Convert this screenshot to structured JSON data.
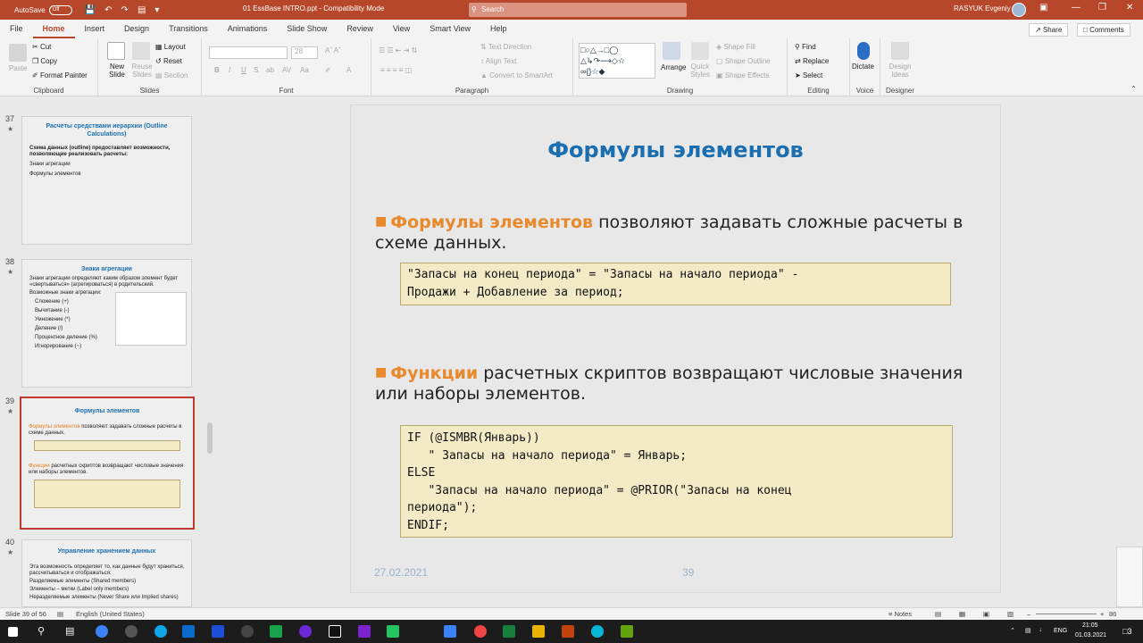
{
  "titlebar": {
    "autosave_label": "AutoSave",
    "autosave_state": "Off",
    "document_title": "01 EssBase INTRO.ppt  -  Compatibility Mode",
    "search_placeholder": "Search",
    "user_name": "RASYUK Evgeniy",
    "accent_color": "#b7472a"
  },
  "tabs": [
    "File",
    "Home",
    "Insert",
    "Design",
    "Transitions",
    "Animations",
    "Slide Show",
    "Review",
    "View",
    "Smart View",
    "Help"
  ],
  "active_tab": "Home",
  "share_label": "Share",
  "comments_label": "Comments",
  "ribbon": {
    "clipboard": {
      "label": "Clipboard",
      "paste": "Paste",
      "cut": "Cut",
      "copy": "Copy",
      "format_painter": "Format Painter"
    },
    "slides": {
      "label": "Slides",
      "new_slide": "New Slide",
      "reuse_slides": "Reuse Slides",
      "layout": "Layout",
      "reset": "Reset",
      "section": "Section"
    },
    "font": {
      "label": "Font",
      "size": "28"
    },
    "paragraph": {
      "label": "Paragraph",
      "text_direction": "Text Direction",
      "align_text": "Align Text",
      "convert_smartart": "Convert to SmartArt"
    },
    "drawing": {
      "label": "Drawing",
      "arrange": "Arrange",
      "quick_styles": "Quick Styles",
      "shape_fill": "Shape Fill",
      "shape_outline": "Shape Outline",
      "shape_effects": "Shape Effects"
    },
    "editing": {
      "label": "Editing",
      "find": "Find",
      "replace": "Replace",
      "select": "Select"
    },
    "voice": {
      "label": "Voice",
      "dictate": "Dictate"
    },
    "designer": {
      "label": "Designer",
      "design_ideas": "Design Ideas"
    }
  },
  "thumbnails": [
    {
      "num": "37",
      "title": "Расчеты средствами иерархии (Outline Calculations)",
      "lines": [
        "Схема данных (outline) предоставляет возможности, позволяющие реализовать расчеты:",
        "Знаки агрегации",
        "Формулы элементов"
      ]
    },
    {
      "num": "38",
      "title": "Знаки агрегации",
      "lines": [
        "Знаки агрегации определяют каким образом элемент будет «свертываться» (агрегироваться) в родительский.",
        "Возможные знаки агрегации:",
        "Сложение (+)",
        "Вычитание (-)",
        "Умножение (*)",
        "Деление (/)",
        "Процентное деление (%)",
        "Игнорирование (~)"
      ]
    },
    {
      "num": "39",
      "title": "Формулы элементов",
      "lines": [
        "позволяют задавать сложные расчеты в схеме данных.",
        "расчетных скриптов возвращают числовые значения или наборы элементов."
      ],
      "hl1": "Формулы элементов",
      "hl2": "Функции"
    },
    {
      "num": "40",
      "title": "Управление хранением данных",
      "lines": [
        "Эта возможность определяет то, как данные будут храниться, рассчитываться и отображаться:",
        "Разделяемые элементы (Shared members)",
        "Элементы – метки (Label only members)",
        "Неразделяемые элементы (Never Share или Implied shares)"
      ]
    }
  ],
  "slide": {
    "title": "Формулы элементов",
    "bullet1_highlight": "Формулы элементов",
    "bullet1_text": " позволяют задавать сложные расчеты в схеме данных.",
    "code1": "\"Запасы на конец периода\" = \"Запасы на начало периода\" -\nПродажи + Добавление за период;",
    "bullet2_highlight": "Функции",
    "bullet2_text": " расчетных скриптов возвращают числовые значения или наборы элементов.",
    "code2": "IF (@ISMBR(Январь))\n   \" Запасы на начало периода\" = Январь;\nELSE\n   \"Запасы на начало периода\" = @PRIOR(\"Запасы на конец\nпериода\");\nENDIF;",
    "footer_date": "27.02.2021",
    "footer_page": "39"
  },
  "status": {
    "slide_counter": "Slide 39 of 56",
    "language": "English (United States)",
    "notes": "Notes",
    "zoom": "86"
  },
  "taskbar": {
    "lang": "ENG",
    "time": "21:05",
    "date": "01.03.2021",
    "notif": "3"
  }
}
